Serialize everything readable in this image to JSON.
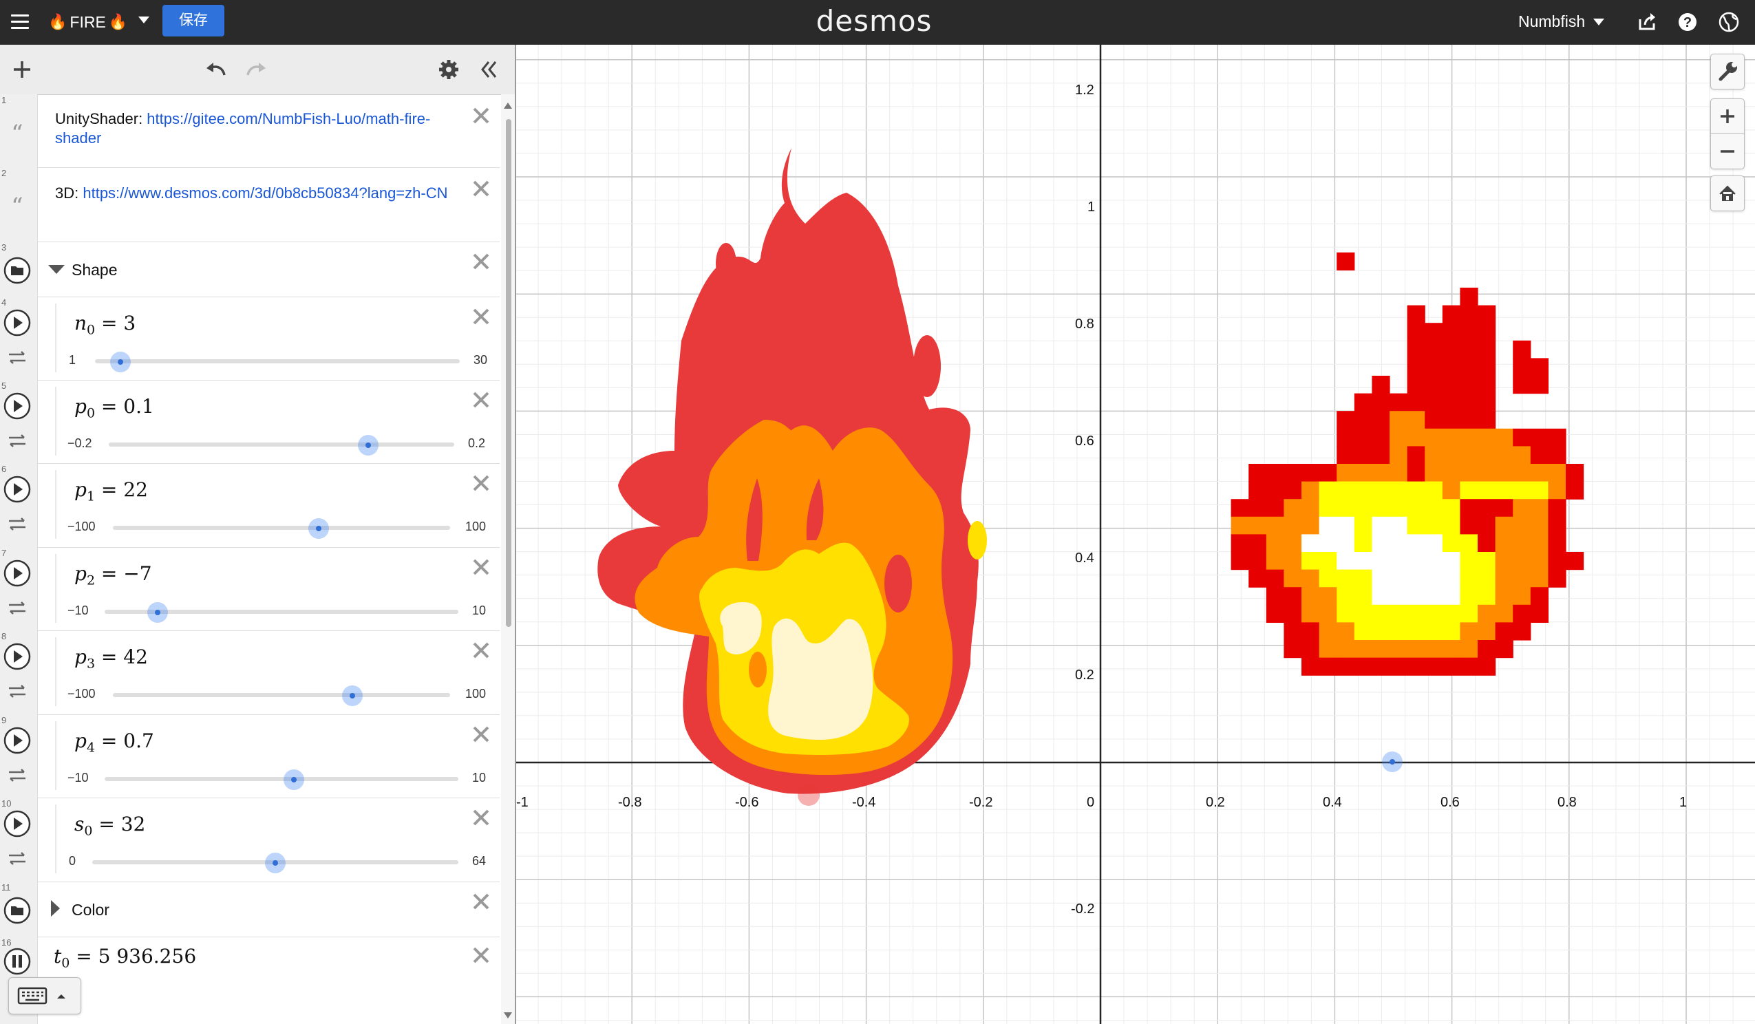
{
  "header": {
    "title": "FIRE",
    "save_label": "保存",
    "logo": "desmos",
    "user": "Numbfish"
  },
  "icons": {
    "menu": "hamburger-icon",
    "flame": "fire-emoji",
    "add": "plus-icon",
    "undo": "undo-icon",
    "redo": "redo-icon",
    "settings": "gear-icon",
    "collapse": "double-chevron-left-icon",
    "share": "share-icon",
    "help": "help-icon",
    "language": "globe-icon",
    "wrench": "wrench-icon",
    "zoom_in": "plus-icon",
    "zoom_out": "minus-icon",
    "home": "home-icon"
  },
  "expressions": {
    "note1": {
      "line": "1",
      "prefix": "UnityShader: ",
      "link": "https://gitee.com/NumbFish-Luo/math-fire-shader"
    },
    "note2": {
      "line": "2",
      "prefix": "3D: ",
      "link": "https://www.desmos.com/3d/0b8cb50834?lang=zh-CN"
    },
    "shape": {
      "line": "3",
      "title": "Shape"
    },
    "n0": {
      "line": "4",
      "var": "n",
      "sub": "0",
      "value": "3",
      "min": "1",
      "max": "30",
      "frac": 0.069
    },
    "p0": {
      "line": "5",
      "var": "p",
      "sub": "0",
      "value": "0.1",
      "min": "−0.2",
      "max": "0.2",
      "frac": 0.75
    },
    "p1": {
      "line": "6",
      "var": "p",
      "sub": "1",
      "value": "22",
      "min": "−100",
      "max": "100",
      "frac": 0.61
    },
    "p2": {
      "line": "7",
      "var": "p",
      "sub": "2",
      "value": "−7",
      "min": "−10",
      "max": "10",
      "frac": 0.15
    },
    "p3": {
      "line": "8",
      "var": "p",
      "sub": "3",
      "value": "42",
      "min": "−100",
      "max": "100",
      "frac": 0.71
    },
    "p4": {
      "line": "9",
      "var": "p",
      "sub": "4",
      "value": "0.7",
      "min": "−10",
      "max": "10",
      "frac": 0.535
    },
    "s0": {
      "line": "10",
      "var": "s",
      "sub": "0",
      "value": "32",
      "min": "0",
      "max": "64",
      "frac": 0.5
    },
    "color": {
      "line": "11",
      "title": "Color"
    },
    "t0": {
      "line": "16",
      "var": "t",
      "sub": "0",
      "value": "5 936.256"
    }
  },
  "graph": {
    "x_ticks": [
      "-1",
      "-0.8",
      "-0.6",
      "-0.4",
      "-0.2",
      "0",
      "0.2",
      "0.4",
      "0.6",
      "0.8",
      "1"
    ],
    "y_ticks": [
      "1.2",
      "1",
      "0.8",
      "0.6",
      "0.4",
      "0.2",
      "-0.2"
    ],
    "colors": {
      "red": "#e83a3a",
      "pixel_red": "#e60000",
      "orange": "#ff8c00",
      "yellow": "#ffe000",
      "cream": "#fff6d0",
      "white": "#ffffff",
      "pixel_yellow": "#ffff00"
    }
  }
}
